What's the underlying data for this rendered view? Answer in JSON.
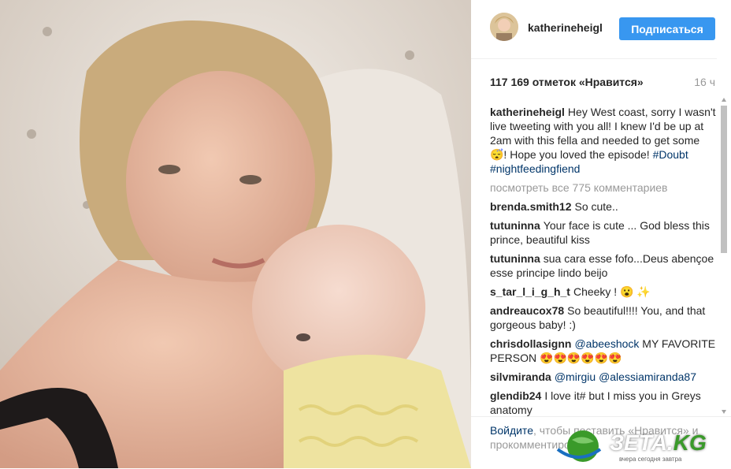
{
  "header": {
    "username": "katherineheigl",
    "follow_label": "Подписаться"
  },
  "stats": {
    "likes": "117 169 отметок «Нравится»",
    "time": "16 ч"
  },
  "caption": {
    "user": "katherineheigl",
    "text": "Hey West coast, sorry I wasn't live tweeting with you all! I knew I'd be up at 2am with this fella and needed to get some 😴! Hope you loved the episode! ",
    "tag1": "#Doubt",
    "tag2": "#nightfeedingfiend"
  },
  "view_all": "посмотреть все 775 комментариев",
  "comments": [
    {
      "user": "brenda.smith12",
      "text": "So cute.."
    },
    {
      "user": "tutuninna",
      "text": "Your face is cute ... God bless this prince, beautiful kiss"
    },
    {
      "user": "tutuninna",
      "text": "sua cara esse fofo...Deus abençoe esse principe lindo beijo"
    },
    {
      "user": "s_tar_l_i_g_h_t",
      "text": "Cheeky ! 😮 ✨"
    },
    {
      "user": "andreaucox78",
      "text": "So beautiful!!!! You, and that gorgeous baby! :)"
    },
    {
      "user": "chrisdollasignn",
      "mention": "@abeeshock",
      "text": " MY FAVORITE PERSON 😍😍😍😍😍😍"
    },
    {
      "user": "silvmiranda",
      "mention": "@mirgiu",
      "mention2": "@alessiamiranda87",
      "text": ""
    },
    {
      "user": "glendib24",
      "text": "I love it# but I miss you in Greys anatomy"
    }
  ],
  "footer": {
    "login": "Войдите",
    "text": ", чтобы поставить «Нравится» и прокомментировать."
  },
  "watermark": {
    "brand": "ЗЕТА.",
    "tld": "KG",
    "tagline": "вчера сегодня завтра"
  },
  "colors": {
    "follow_button": "#3897f0",
    "link": "#003569",
    "muted": "#999999"
  }
}
